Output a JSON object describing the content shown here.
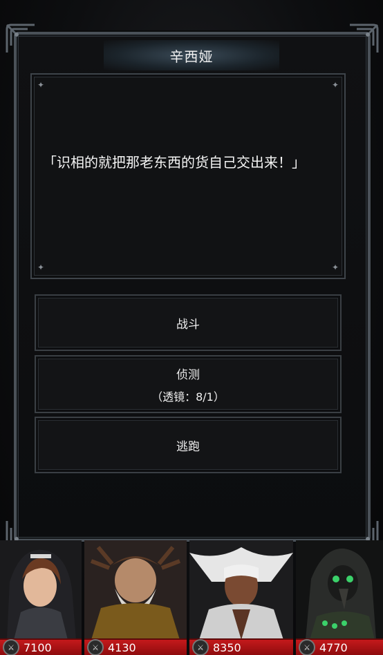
{
  "dialog": {
    "speaker": "辛西娅",
    "line": "「识相的就把那老东西的货自己交出来！」"
  },
  "options": {
    "fight": "战斗",
    "scout": "侦测",
    "scout_cost": "（透镜：8/1）",
    "flee": "逃跑"
  },
  "party": [
    {
      "power": "7100"
    },
    {
      "power": "4130"
    },
    {
      "power": "8350"
    },
    {
      "power": "4770"
    }
  ],
  "colors": {
    "power_bar": "#c4191b",
    "frame": "#4a5158"
  }
}
